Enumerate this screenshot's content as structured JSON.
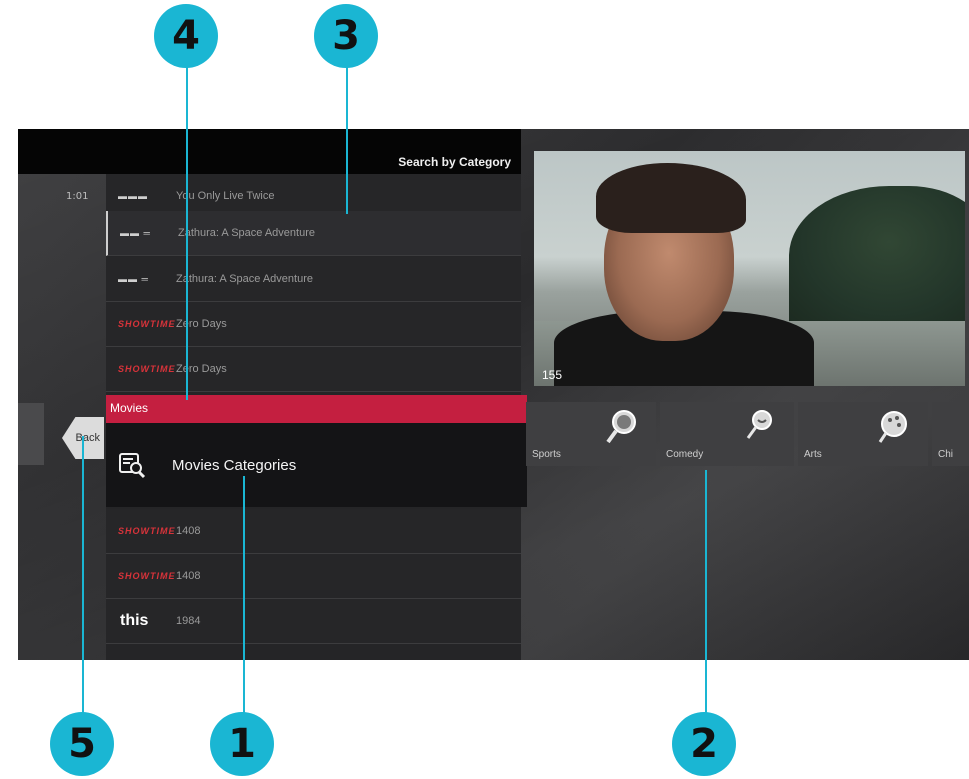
{
  "screen": {
    "section_title": "Search by Category"
  },
  "listings": [
    {
      "time": "1:01",
      "logo": "",
      "title": "You Only Live Twice"
    },
    {
      "time": "",
      "logo": "",
      "title": "Zathura: A Space Adventure"
    },
    {
      "time": "",
      "logo": "",
      "title": "Zathura: A Space Adventure"
    },
    {
      "time": "",
      "logo": "SHOWTIME",
      "title": "Zero Days"
    },
    {
      "time": "",
      "logo": "SHOWTIME",
      "title": "Zero Days"
    },
    {
      "time": "",
      "logo": "SHOWTIME",
      "title": "1408"
    },
    {
      "time": "",
      "logo": "SHOWTIME",
      "title": "1408"
    },
    {
      "time": "",
      "logo": "this",
      "title": "1984"
    }
  ],
  "popup": {
    "header": "Movies",
    "item_label": "Movies Categories",
    "item_icon": "category-search-icon"
  },
  "back_button": {
    "label": "Back"
  },
  "video": {
    "channel_number": "155"
  },
  "categories": [
    {
      "label": "Sports",
      "icon": "search-magnifier-icon"
    },
    {
      "label": "Comedy",
      "icon": "comedy-magnifier-icon"
    },
    {
      "label": "Arts",
      "icon": "arts-palette-icon"
    },
    {
      "label": "Chi",
      "icon": ""
    }
  ],
  "callouts": [
    "1",
    "2",
    "3",
    "4",
    "5"
  ],
  "colors": {
    "accent_red": "#c41f40",
    "callout_blue": "#1ab6d3"
  }
}
